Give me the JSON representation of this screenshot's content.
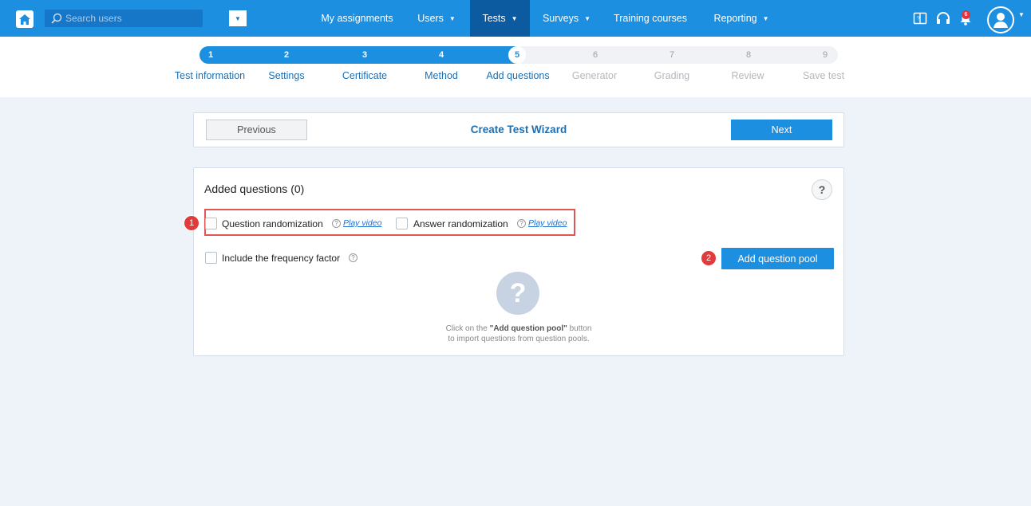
{
  "header": {
    "search": {
      "placeholder": "Search users"
    },
    "nav": [
      {
        "label": "My assignments",
        "has_dropdown": false,
        "active": false
      },
      {
        "label": "Users",
        "has_dropdown": true,
        "active": false
      },
      {
        "label": "Tests",
        "has_dropdown": true,
        "active": true
      },
      {
        "label": "Surveys",
        "has_dropdown": true,
        "active": false
      },
      {
        "label": "Training courses",
        "has_dropdown": false,
        "active": false
      },
      {
        "label": "Reporting",
        "has_dropdown": true,
        "active": false
      }
    ],
    "icons": [
      "home-icon",
      "search-icon",
      "book-icon",
      "headset-icon",
      "bell-icon",
      "user-avatar-icon"
    ],
    "notification_count": "6"
  },
  "wizard_steps": {
    "current_step": 5,
    "total_steps": 9,
    "steps": [
      {
        "number": "1",
        "label": "Test information"
      },
      {
        "number": "2",
        "label": "Settings"
      },
      {
        "number": "3",
        "label": "Certificate"
      },
      {
        "number": "4",
        "label": "Method"
      },
      {
        "number": "5",
        "label": "Add questions"
      },
      {
        "number": "6",
        "label": "Generator"
      },
      {
        "number": "7",
        "label": "Grading"
      },
      {
        "number": "8",
        "label": "Review"
      },
      {
        "number": "9",
        "label": "Save test"
      }
    ]
  },
  "wizard_header": {
    "previous_label": "Previous",
    "title": "Create Test Wizard",
    "next_label": "Next"
  },
  "questions": {
    "title": "Added questions (0)",
    "help_glyph": "?",
    "question_randomization": {
      "label": "Question randomization",
      "link": "Play video",
      "checked": false
    },
    "answer_randomization": {
      "label": "Answer randomization",
      "link": "Play video",
      "checked": false
    },
    "frequency_factor": {
      "label": "Include the frequency factor",
      "checked": false
    },
    "add_pool_label": "Add question pool",
    "empty_state": {
      "line1_prefix": "Click on the ",
      "line1_bold": "\"Add question pool\"",
      "line1_suffix": " button",
      "line2": "to import questions from question pools."
    }
  },
  "annotations": {
    "marker_1": "1",
    "marker_2": "2"
  },
  "colors": {
    "primary": "#1d8fe1",
    "active_nav": "#0c5ba1",
    "marker": "#e23b3b",
    "background": "#eef3f9"
  }
}
